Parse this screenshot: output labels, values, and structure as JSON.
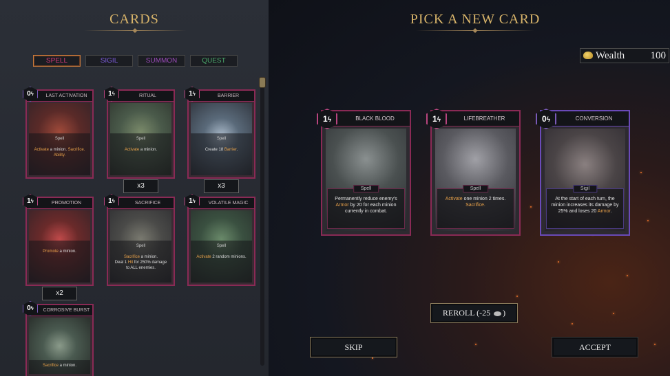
{
  "left_title": "CARDS",
  "right_title": "PICK A NEW CARD",
  "filters": [
    {
      "label": "SPELL",
      "color": "#d23a7a"
    },
    {
      "label": "SIGIL",
      "color": "#7a5ad8"
    },
    {
      "label": "SUMMON",
      "color": "#9a4ab8"
    },
    {
      "label": "QUEST",
      "color": "#4aa86a"
    }
  ],
  "collection": [
    {
      "name": "LAST ACTIVATION",
      "cost": "0",
      "type": "Spell",
      "text_html": "<span class='kw'>Activate</span> a minion. <span class='kw'>Sacrifice. Ability.</span>",
      "count": ""
    },
    {
      "name": "RITUAL",
      "cost": "1",
      "type": "Spell",
      "text_html": "<span class='kw'>Activate</span> a minion.",
      "count": "x3"
    },
    {
      "name": "BARRIER",
      "cost": "1",
      "type": "Spell",
      "text_html": "Create 18 <span class='kw'>Barrier</span>.",
      "count": "x3"
    },
    {
      "name": "PROMOTION",
      "cost": "1",
      "type": "",
      "text_html": "<span class='kw'>Promote</span> a minion.",
      "count": "x2"
    },
    {
      "name": "SACRIFICE",
      "cost": "1",
      "type": "Spell",
      "text_html": "<span class='kw'>Sacrifice</span> a minion.<br>Deal 1 <span class='kw'>Hit</span> for 250% damage to ALL enemies.",
      "count": ""
    },
    {
      "name": "VOLATILE MAGIC",
      "cost": "1",
      "type": "Spell",
      "text_html": "<span class='kw'>Activate</span> 2 random minions.",
      "count": ""
    },
    {
      "name": "CORROSIVE BURST",
      "cost": "0",
      "type": "",
      "text_html": "<span class='kw'>Sacrifice</span> a minion.",
      "count": ""
    }
  ],
  "offers": [
    {
      "name": "BLACK BLOOD",
      "cost": "1",
      "type": "Spell",
      "text_html": "Permanently reduce enemy's <span class='kw'>Armor</span> by 20 for each minion currently in combat."
    },
    {
      "name": "LIFEBREATHER",
      "cost": "1",
      "type": "Spell",
      "text_html": "<span class='kw'>Activate</span> one minion 2 times.<br><span class='kw'>Sacrifice.</span>"
    },
    {
      "name": "CONVERSION",
      "cost": "0",
      "type": "Sigil",
      "text_html": "At the start of each turn, the minion increases its damage by 25% and loses 20 <span class='kw'>Armor</span>."
    }
  ],
  "wealth": {
    "label": "Wealth",
    "value": "100"
  },
  "buttons": {
    "reroll": "REROLL (-25",
    "reroll_suffix": ")",
    "skip": "SKIP",
    "accept": "ACCEPT"
  },
  "energy_glyph": "ϟ"
}
